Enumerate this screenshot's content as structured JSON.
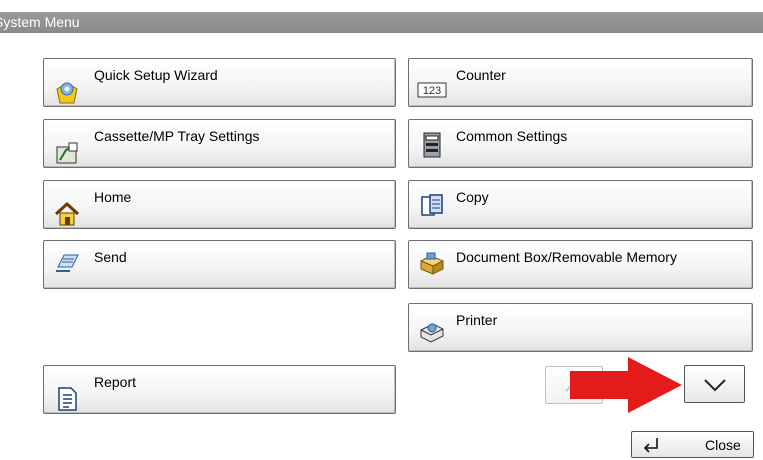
{
  "window": {
    "title": "System Menu"
  },
  "menu": {
    "left": [
      {
        "label": "Quick Setup Wizard",
        "icon": "setup-wizard-icon"
      },
      {
        "label": "Cassette/MP Tray Settings",
        "icon": "tray-settings-icon"
      },
      {
        "label": "Home",
        "icon": "home-icon"
      },
      {
        "label": "Send",
        "icon": "send-icon"
      },
      {
        "label": "Report",
        "icon": "report-icon"
      }
    ],
    "right": [
      {
        "label": "Counter",
        "icon": "counter-icon",
        "icon_text": "123"
      },
      {
        "label": "Common Settings",
        "icon": "common-settings-icon"
      },
      {
        "label": "Copy",
        "icon": "copy-icon"
      },
      {
        "label": "Document Box/Removable Memory",
        "icon": "document-box-icon"
      },
      {
        "label": "Printer",
        "icon": "printer-icon"
      }
    ]
  },
  "pager": {
    "up_enabled": false,
    "down_enabled": true
  },
  "footer": {
    "close_label": "Close"
  },
  "annotation": {
    "color": "#e31b1b"
  }
}
